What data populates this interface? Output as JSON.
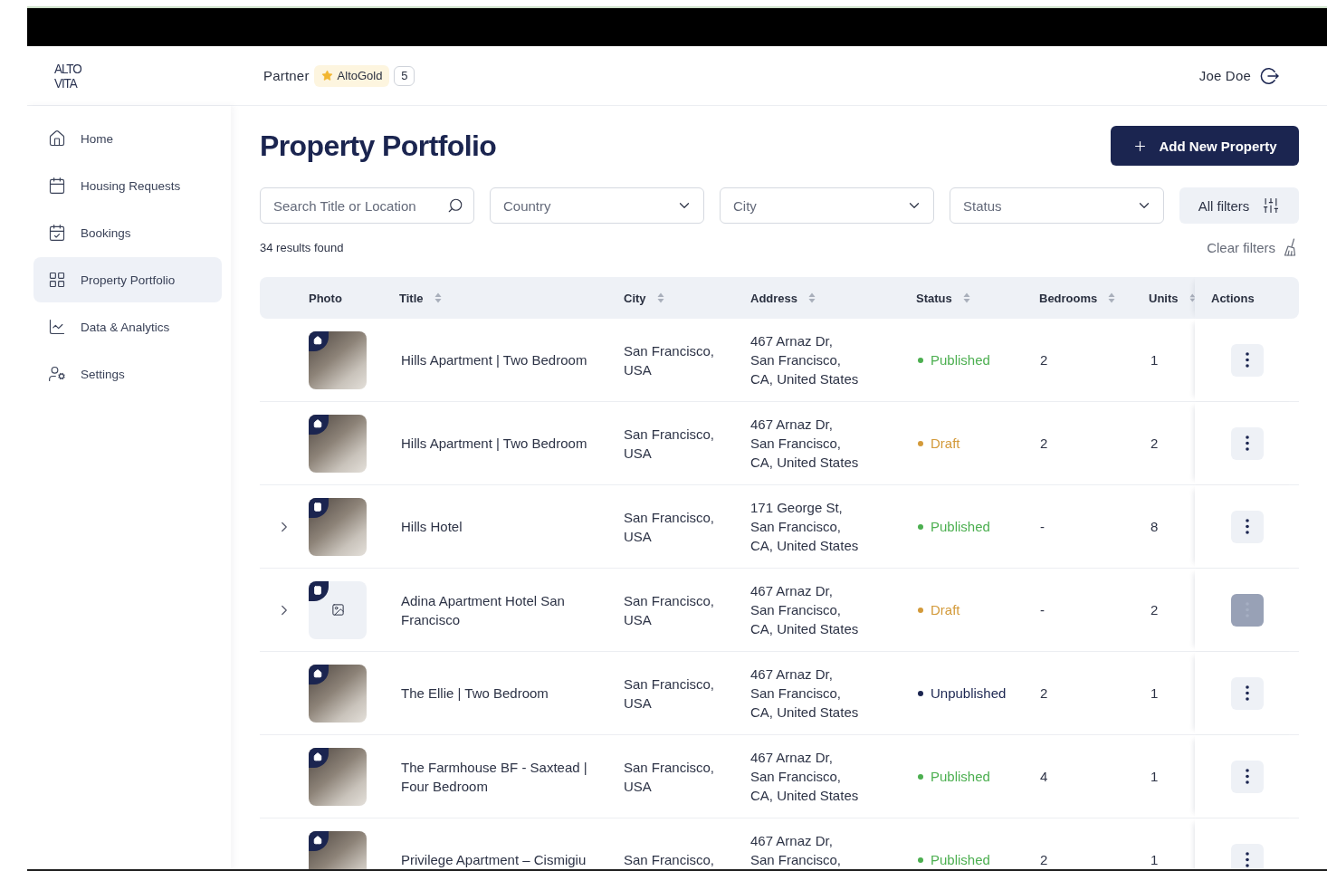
{
  "header": {
    "logo_lines": [
      "ALTO",
      "VITA"
    ],
    "role": "Partner",
    "tier": "AltoGold",
    "count": "5",
    "user_name": "Joe Doe"
  },
  "sidebar": {
    "items": [
      {
        "label": "Home",
        "selected": false
      },
      {
        "label": "Housing Requests",
        "selected": false
      },
      {
        "label": "Bookings",
        "selected": false
      },
      {
        "label": "Property Portfolio",
        "selected": true
      },
      {
        "label": "Data & Analytics",
        "selected": false
      },
      {
        "label": "Settings",
        "selected": false
      }
    ]
  },
  "page": {
    "title": "Property Portfolio",
    "add_button": "Add New Property"
  },
  "filters": {
    "search": {
      "placeholder": "Search Title or Location"
    },
    "dropdowns": [
      {
        "placeholder": "Country"
      },
      {
        "placeholder": "City"
      },
      {
        "placeholder": "Status"
      }
    ],
    "all_filters": "All filters",
    "results": "34 results found",
    "clear_filters": "Clear filters"
  },
  "table": {
    "columns": [
      {
        "label": "Photo",
        "sortable": false
      },
      {
        "label": "Title",
        "sortable": true
      },
      {
        "label": "City",
        "sortable": true
      },
      {
        "label": "Address",
        "sortable": true
      },
      {
        "label": "Status",
        "sortable": true
      },
      {
        "label": "Bedrooms",
        "sortable": true
      },
      {
        "label": "Units",
        "sortable": true
      },
      {
        "label": "Actions",
        "sortable": false
      }
    ],
    "rows": [
      {
        "kind": "unit",
        "has_photo": true,
        "title": "Hills Apartment | Two Bedroom",
        "city": [
          "San Francisco,",
          "USA"
        ],
        "address": [
          "467 Arnaz Dr,",
          "San Francisco,",
          "CA, United States"
        ],
        "status": {
          "label": "Published",
          "color": "#4caf50"
        },
        "bedrooms": "2",
        "units": "1",
        "menu_active": false
      },
      {
        "kind": "unit",
        "has_photo": true,
        "title": "Hills Apartment | Two Bedroom",
        "city": [
          "San Francisco,",
          "USA"
        ],
        "address": [
          "467 Arnaz Dr,",
          "San Francisco,",
          "CA, United States"
        ],
        "status": {
          "label": "Draft",
          "color": "#d39a3a"
        },
        "bedrooms": "2",
        "units": "2",
        "menu_active": false
      },
      {
        "kind": "building",
        "has_photo": true,
        "title": "Hills Hotel",
        "city": [
          "San Francisco,",
          "USA"
        ],
        "address": [
          "171 George St,",
          "San Francisco,",
          "CA, United States"
        ],
        "status": {
          "label": "Published",
          "color": "#4caf50"
        },
        "bedrooms": "-",
        "units": "8",
        "menu_active": false
      },
      {
        "kind": "building",
        "has_photo": false,
        "title": "Adina Apartment Hotel San Francisco",
        "city": [
          "San Francisco,",
          "USA"
        ],
        "address": [
          "467 Arnaz Dr,",
          "San Francisco,",
          "CA, United States"
        ],
        "status": {
          "label": "Draft",
          "color": "#d39a3a"
        },
        "bedrooms": "-",
        "units": "2",
        "menu_active": true
      },
      {
        "kind": "unit",
        "has_photo": true,
        "title": "The Ellie | Two Bedroom",
        "city": [
          "San Francisco,",
          "USA"
        ],
        "address": [
          "467 Arnaz Dr,",
          "San Francisco,",
          "CA, United States"
        ],
        "status": {
          "label": "Unpublished",
          "color": "#1b2550"
        },
        "bedrooms": "2",
        "units": "1",
        "menu_active": false
      },
      {
        "kind": "unit",
        "has_photo": true,
        "title": "The Farmhouse BF - Saxtead | Four Bedroom",
        "city": [
          "San Francisco,",
          "USA"
        ],
        "address": [
          "467 Arnaz Dr,",
          "San Francisco,",
          "CA, United States"
        ],
        "status": {
          "label": "Published",
          "color": "#4caf50"
        },
        "bedrooms": "4",
        "units": "1",
        "menu_active": false
      },
      {
        "kind": "unit",
        "has_photo": true,
        "title": "Privilege Apartment – Cismigiu",
        "city": [
          "San Francisco,"
        ],
        "address": [
          "467 Arnaz Dr,",
          "San Francisco,"
        ],
        "status": {
          "label": "Published",
          "color": "#4caf50"
        },
        "bedrooms": "2",
        "units": "1",
        "menu_active": false
      }
    ]
  }
}
